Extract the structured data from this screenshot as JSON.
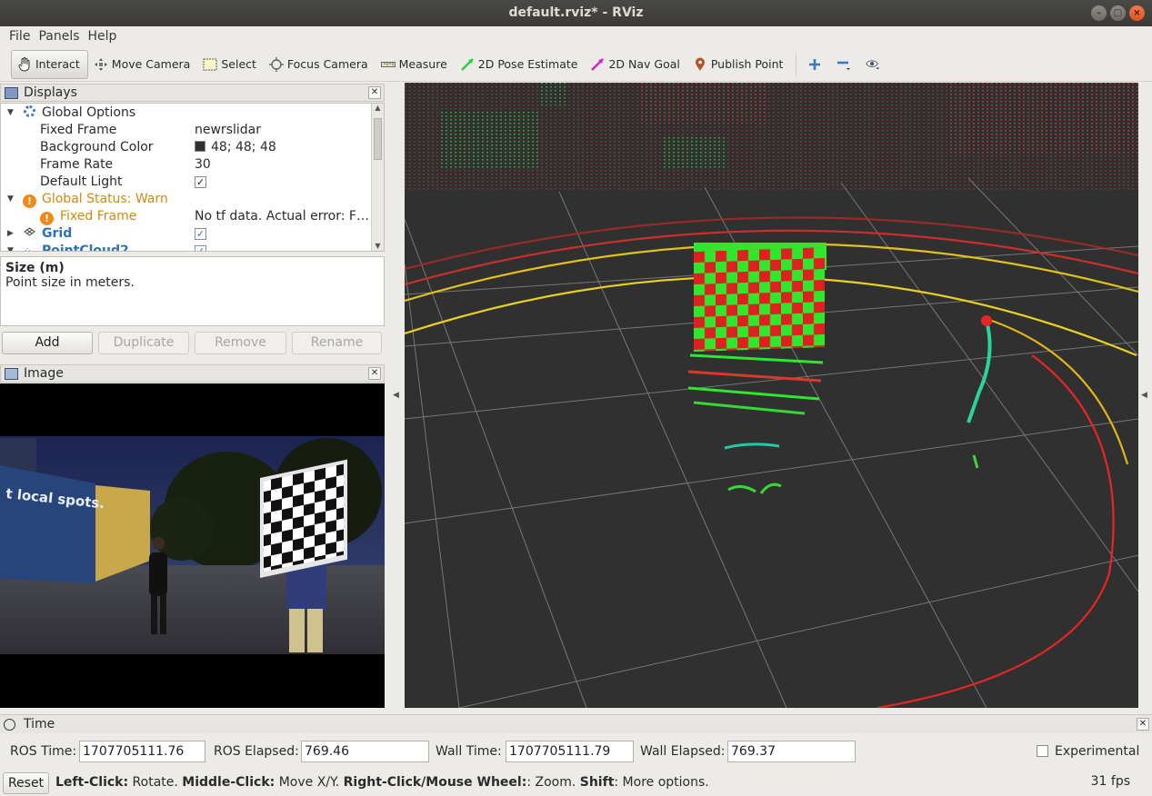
{
  "window": {
    "title": "default.rviz* - RViz"
  },
  "menu": [
    "File",
    "Panels",
    "Help"
  ],
  "toolbar": {
    "tools": [
      {
        "label": "Interact",
        "icon": "hand-icon",
        "active": true
      },
      {
        "label": "Move Camera",
        "icon": "move-camera-icon",
        "active": false
      },
      {
        "label": "Select",
        "icon": "select-icon",
        "active": false
      },
      {
        "label": "Focus Camera",
        "icon": "focus-camera-icon",
        "active": false
      },
      {
        "label": "Measure",
        "icon": "measure-icon",
        "active": false
      },
      {
        "label": "2D Pose Estimate",
        "icon": "pose-estimate-icon",
        "active": false
      },
      {
        "label": "2D Nav Goal",
        "icon": "nav-goal-icon",
        "active": false
      },
      {
        "label": "Publish Point",
        "icon": "publish-point-icon",
        "active": false
      }
    ]
  },
  "displays": {
    "title": "Displays",
    "tree": {
      "global_options": "Global Options",
      "fixed_frame_label": "Fixed Frame",
      "fixed_frame_value": "newrslidar",
      "background_color_label": "Background Color",
      "background_color_value": "48; 48; 48",
      "frame_rate_label": "Frame Rate",
      "frame_rate_value": "30",
      "default_light_label": "Default Light",
      "global_status": "Global Status: Warn",
      "status_fixed_frame": "Fixed Frame",
      "status_fixed_frame_value": "No tf data.  Actual error: F…",
      "grid": "Grid",
      "pointcloud": "PointCloud2"
    },
    "description_title": "Size (m)",
    "description_text": "Point size in meters.",
    "buttons": {
      "add": "Add",
      "duplicate": "Duplicate",
      "remove": "Remove",
      "rename": "Rename"
    }
  },
  "image_panel": {
    "title": "Image",
    "sign_text": "t local spots."
  },
  "time_panel": {
    "title": "Time",
    "ros_time_label": "ROS Time:",
    "ros_time_value": "1707705111.76",
    "ros_elapsed_label": "ROS Elapsed:",
    "ros_elapsed_value": "769.46",
    "wall_time_label": "Wall Time:",
    "wall_time_value": "1707705111.79",
    "wall_elapsed_label": "Wall Elapsed:",
    "wall_elapsed_value": "769.37",
    "experimental_label": "Experimental"
  },
  "status": {
    "reset_label": "Reset",
    "left_click_key": "Left-Click:",
    "left_click_text": " Rotate. ",
    "middle_click_key": "Middle-Click:",
    "middle_click_text": " Move X/Y. ",
    "right_click_key": "Right-Click/Mouse Wheel:",
    "right_click_text": ": Zoom. ",
    "shift_key": "Shift",
    "shift_text": ": More options.",
    "fps": "31 fps"
  },
  "colors": {
    "viewport_bg": "#303030",
    "warn": "#d08a0d",
    "accent_blue": "#2d71b8"
  }
}
